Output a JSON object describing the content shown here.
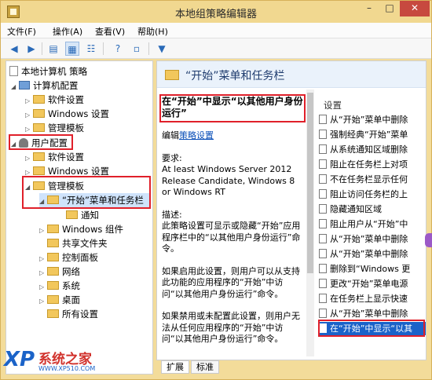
{
  "window": {
    "title": "本地组策略编辑器"
  },
  "menu": [
    "文件(F)",
    "操作(A)",
    "查看(V)",
    "帮助(H)"
  ],
  "tree": {
    "root": "本地计算机 策略",
    "computer_config": "计算机配置",
    "cc_software": "软件设置",
    "cc_windows": "Windows 设置",
    "cc_admin": "管理模板",
    "user_config": "用户配置",
    "uc_software": "软件设置",
    "uc_windows": "Windows 设置",
    "uc_admin": "管理模板",
    "start_taskbar": "“开始”菜单和任务栏",
    "notify": "通知",
    "win_components": "Windows 组件",
    "shared_folders": "共享文件夹",
    "control_panel": "控制面板",
    "network": "网络",
    "system": "系统",
    "desktop": "桌面",
    "all_settings": "所有设置"
  },
  "right": {
    "header": "“开始”菜单和任务栏",
    "policy_title": "在“开始”中显示“以其他用户身份运行”",
    "edit_prefix": "编辑",
    "edit_link": "策略设置",
    "req_label": "要求:",
    "req_text": "At least Windows Server 2012 Release Candidate, Windows 8 or Windows RT",
    "desc_label": "描述:",
    "desc_text": "此策略设置可显示或隐藏“开始”应用程序栏中的“以其他用户身份运行”命令。",
    "enabled_text": "如果启用此设置，则用户可以从支持此功能的应用程序的“开始”中访问“以其他用户身份运行”命令。",
    "disabled_text": "如果禁用或未配置此设置，则用户无法从任何应用程序的“开始”中访问“以其他用户身份运行”命令。",
    "list_header": "设置",
    "items": [
      "从“开始”菜单中删除",
      "强制经典“开始”菜单",
      "从系统通知区域删除",
      "阻止在任务栏上对项",
      "不在任务栏显示任何",
      "阻止访问任务栏的上",
      "隐藏通知区域",
      "阻止用户从“开始”中",
      "从“开始”菜单中删除",
      "从“开始”菜单中删除",
      "删除到“Windows 更",
      "更改“开始”菜单电源",
      "在任务栏上显示快速",
      "从“开始”菜单中删除",
      "在“开始”中显示“以其"
    ]
  },
  "tabs": [
    "扩展",
    "标准"
  ],
  "watermark": {
    "logo": "XP",
    "name": "系统之家",
    "url": "WWW.XP510.COM"
  }
}
